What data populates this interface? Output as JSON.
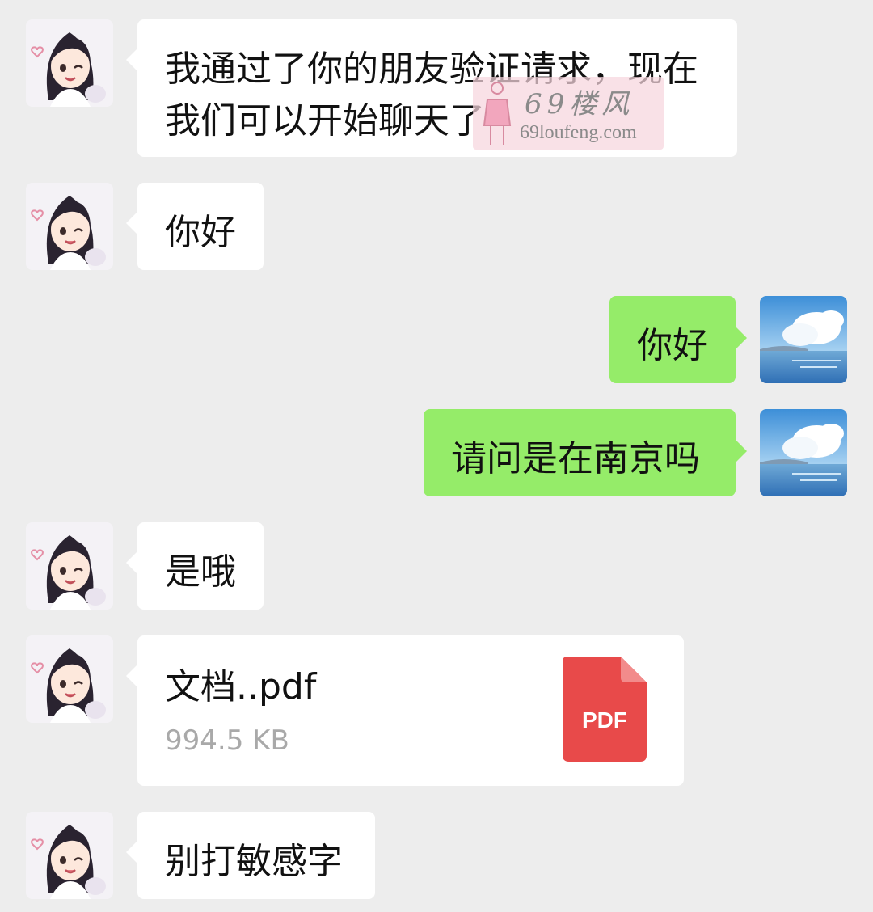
{
  "messages": [
    {
      "side": "incoming",
      "type": "text",
      "text": "我通过了你的朋友验证请求，现在我们可以开始聊天了"
    },
    {
      "side": "incoming",
      "type": "text",
      "text": "你好"
    },
    {
      "side": "outgoing",
      "type": "text",
      "text": "你好"
    },
    {
      "side": "outgoing",
      "type": "text",
      "text": "请问是在南京吗"
    },
    {
      "side": "incoming",
      "type": "text",
      "text": "是哦"
    },
    {
      "side": "incoming",
      "type": "file",
      "file_name": "文档..pdf",
      "file_size": "994.5 KB",
      "file_icon_label": "PDF",
      "file_icon": "pdf-file-icon"
    },
    {
      "side": "incoming",
      "type": "text",
      "text": "别打敏感字"
    }
  ],
  "watermark": {
    "title": "69楼风",
    "url": "69loufeng.com"
  },
  "colors": {
    "background": "#ededed",
    "incoming_bubble": "#ffffff",
    "outgoing_bubble": "#95ec69",
    "pdf_icon": "#e84a4a",
    "file_size_text": "#a9a9a9"
  },
  "avatars": {
    "contact": "anime-girl-avatar",
    "self": "sea-sky-avatar"
  }
}
